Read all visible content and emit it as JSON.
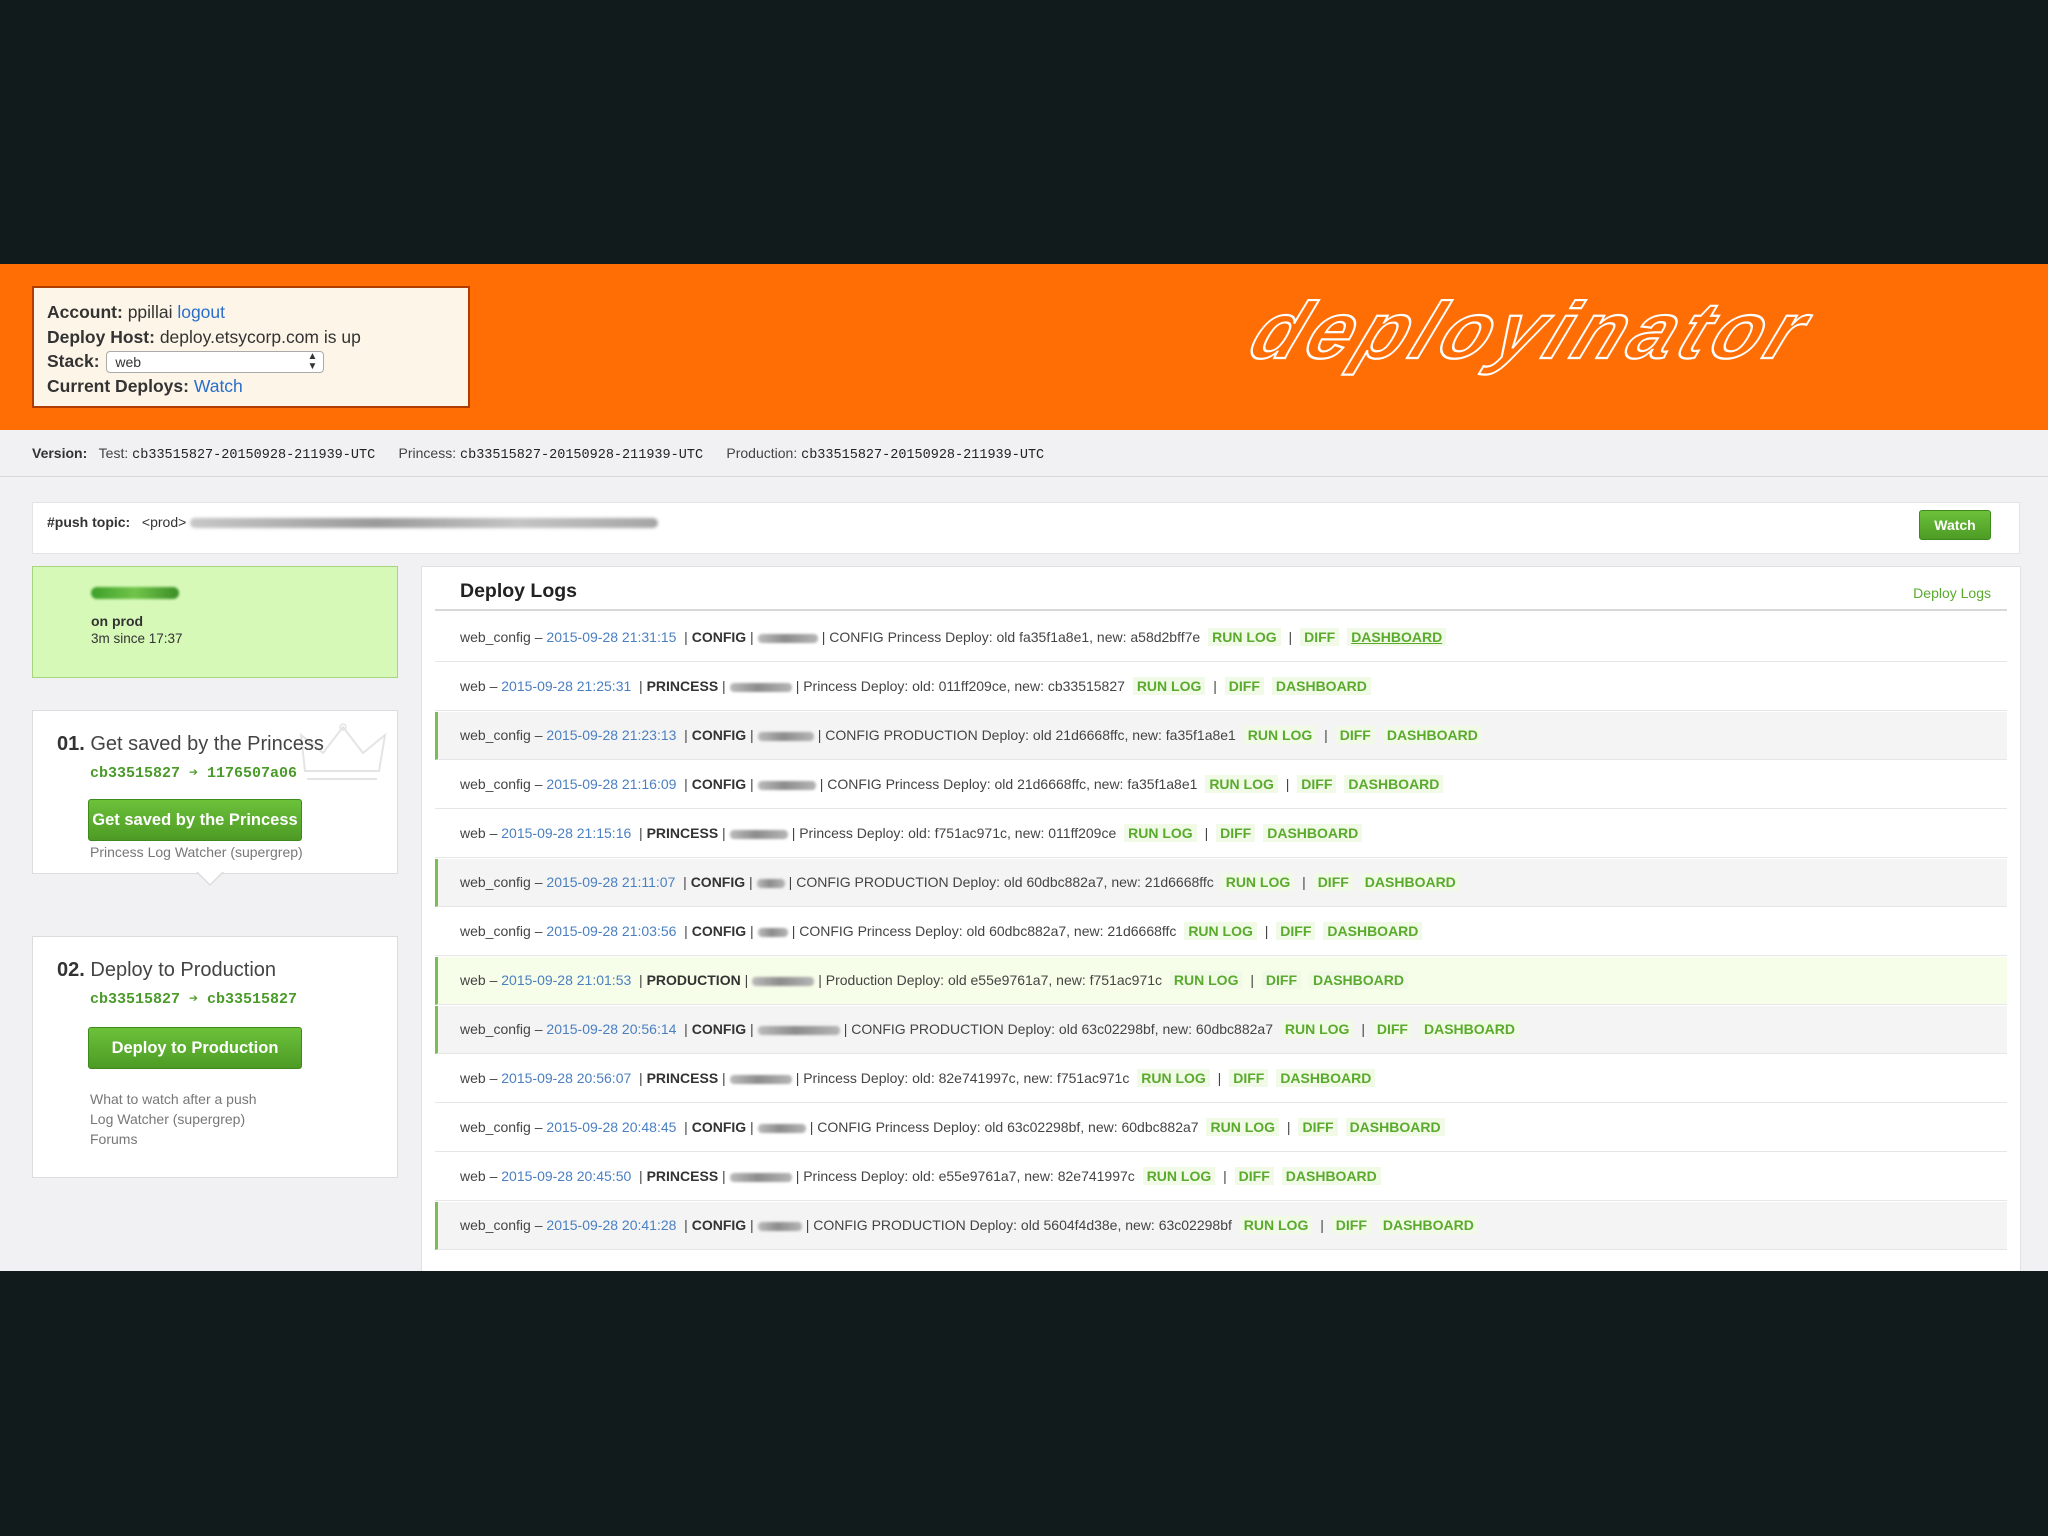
{
  "account": {
    "account_label": "Account:",
    "user": "ppillai",
    "logout_label": "logout",
    "host_label": "Deploy Host:",
    "host_status": "deploy.etsycorp.com is up",
    "stack_label": "Stack:",
    "stack_value": "web",
    "current_label": "Current Deploys:",
    "watch_link": "Watch"
  },
  "logo": {
    "text": "deployinator",
    "color": "#ffffff"
  },
  "versions": {
    "label": "Version:",
    "test_label": "Test:",
    "test": "cb33515827-20150928-211939-UTC",
    "princess_label": "Princess:",
    "princess": "cb33515827-20150928-211939-UTC",
    "production_label": "Production:",
    "production": "cb33515827-20150928-211939-UTC"
  },
  "push_topic": {
    "label": "#push topic:",
    "prefix": "<prod>",
    "watch_label": "Watch"
  },
  "status": {
    "line1": "on prod",
    "line2": "3m since 17:37"
  },
  "steps": [
    {
      "num": "01.",
      "title": "Get saved by the Princess",
      "sha": "cb33515827 ➔ 1176507a06",
      "button": "Get saved by the Princess",
      "links": [
        "Princess Log Watcher (supergrep)"
      ]
    },
    {
      "num": "02.",
      "title": "Deploy to Production",
      "sha": "cb33515827 ➔ cb33515827",
      "button": "Deploy to Production",
      "links": [
        "What to watch after a push",
        "Log Watcher (supergrep)",
        "Forums"
      ]
    }
  ],
  "logs": {
    "title": "Deploy Logs",
    "header_link": "Deploy Logs",
    "actions": {
      "run_log": "RUN LOG",
      "diff": "DIFF",
      "dashboard": "DASHBOARD"
    },
    "rows": [
      {
        "stack": "web_config",
        "date": "2015-09-28 21:31:15",
        "env": "CONFIG",
        "msg": "CONFIG Princess Deploy: old fa35f1a8e1, new: a58d2bff7e"
      },
      {
        "stack": "web",
        "date": "2015-09-28 21:25:31",
        "env": "PRINCESS",
        "msg": "Princess Deploy: old: 011ff209ce, new: cb33515827"
      },
      {
        "stack": "web_config",
        "date": "2015-09-28 21:23:13",
        "env": "CONFIG",
        "msg": "CONFIG PRODUCTION Deploy: old 21d6668ffc, new: fa35f1a8e1"
      },
      {
        "stack": "web_config",
        "date": "2015-09-28 21:16:09",
        "env": "CONFIG",
        "msg": "CONFIG Princess Deploy: old 21d6668ffc, new: fa35f1a8e1"
      },
      {
        "stack": "web",
        "date": "2015-09-28 21:15:16",
        "env": "PRINCESS",
        "msg": "Princess Deploy: old: f751ac971c, new: 011ff209ce"
      },
      {
        "stack": "web_config",
        "date": "2015-09-28 21:11:07",
        "env": "CONFIG",
        "msg": "CONFIG PRODUCTION Deploy: old 60dbc882a7, new: 21d6668ffc"
      },
      {
        "stack": "web_config",
        "date": "2015-09-28 21:03:56",
        "env": "CONFIG",
        "msg": "CONFIG Princess Deploy: old 60dbc882a7, new: 21d6668ffc"
      },
      {
        "stack": "web",
        "date": "2015-09-28 21:01:53",
        "env": "PRODUCTION",
        "msg": "Production Deploy: old e55e9761a7, new: f751ac971c"
      },
      {
        "stack": "web_config",
        "date": "2015-09-28 20:56:14",
        "env": "CONFIG",
        "msg": "CONFIG PRODUCTION Deploy: old 63c02298bf, new: 60dbc882a7"
      },
      {
        "stack": "web",
        "date": "2015-09-28 20:56:07",
        "env": "PRINCESS",
        "msg": "Princess Deploy: old: 82e741997c, new: f751ac971c"
      },
      {
        "stack": "web_config",
        "date": "2015-09-28 20:48:45",
        "env": "CONFIG",
        "msg": "CONFIG Princess Deploy: old 63c02298bf, new: 60dbc882a7"
      },
      {
        "stack": "web",
        "date": "2015-09-28 20:45:50",
        "env": "PRINCESS",
        "msg": "Princess Deploy: old: e55e9761a7, new: 82e741997c"
      },
      {
        "stack": "web_config",
        "date": "2015-09-28 20:41:28",
        "env": "CONFIG",
        "msg": "CONFIG PRODUCTION Deploy: old 5604f4d38e, new: 63c02298bf"
      }
    ]
  },
  "colors": {
    "header": "#ff6d05",
    "accent_green": "#5aaa2e",
    "link_blue": "#2a6ec9"
  }
}
